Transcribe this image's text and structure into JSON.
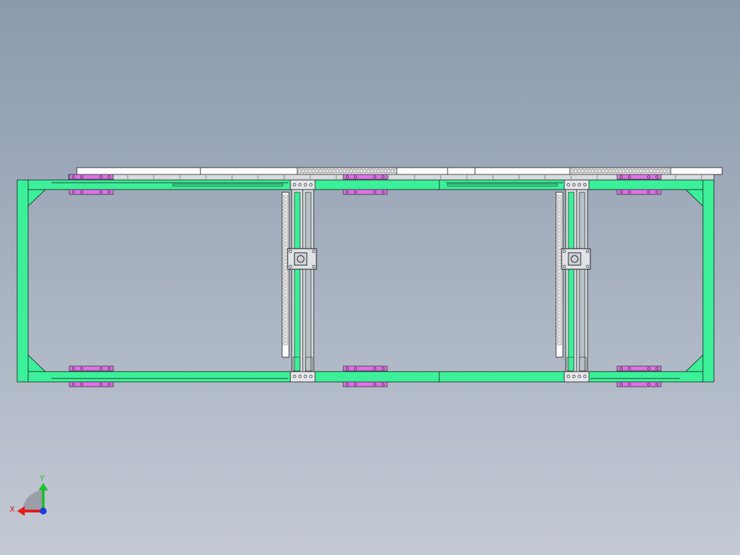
{
  "viewport": {
    "background_top": "#8a9aad",
    "background_bottom": "#c4c9d4"
  },
  "colors": {
    "frame_fill": "#3cf09a",
    "frame_stroke": "#1f3b2c",
    "pad_fill": "#e070e6",
    "part_fill": "#ffffff",
    "part_stroke": "#333333",
    "detail_stroke": "#444444"
  },
  "triad": {
    "x_label": "X",
    "y_label": "Y",
    "x_color": "#e41a1a",
    "y_color": "#1fbf2e",
    "z_color": "#1a3ddc",
    "arc_color": "#9a9ea6"
  }
}
